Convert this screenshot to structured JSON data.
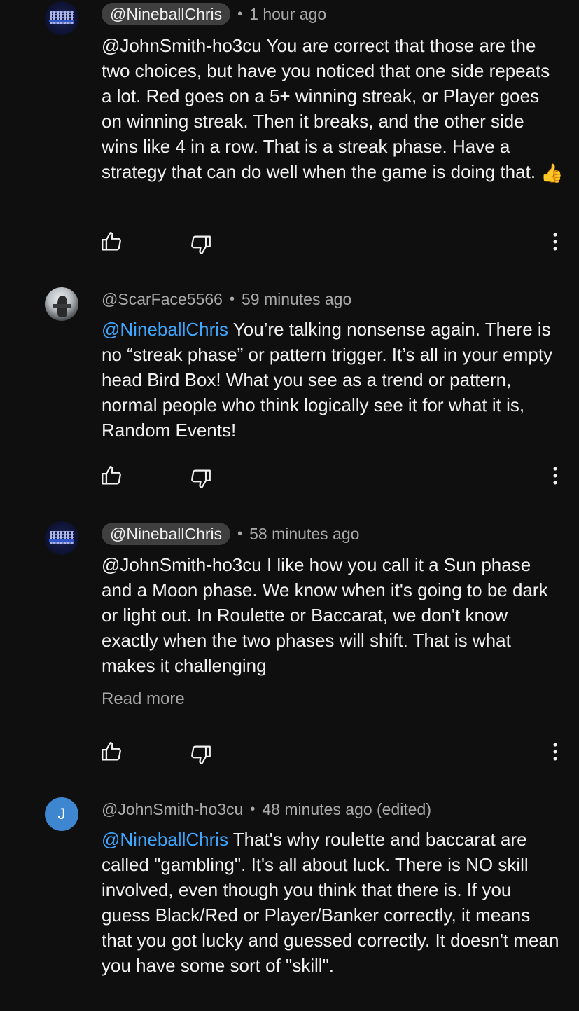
{
  "comments": [
    {
      "author": "@NineballChris",
      "author_style": "chip",
      "time": "1 hour ago",
      "text": "@JohnSmith-ho3cu You are correct that those are the two choices, but have you noticed that one side repeats a lot. Red goes on a 5+ winning streak, or Player goes on winning streak. Then it breaks, and the other side wins like 4 in a row. That is a streak phase. Have a strategy that can do well when the game is doing that.",
      "emoji": "👍",
      "avatar": "nineballchris-avatar"
    },
    {
      "author": "@ScarFace5566",
      "author_style": "plain",
      "time": "59 minutes ago",
      "mention": "@NineballChris",
      "text": "You’re talking nonsense again. There is no “streak phase” or pattern trigger. It’s all in your empty head Bird Box! What you see as a trend or pattern, normal people who think logically see it for what it is, Random Events!",
      "avatar": "scarface-avatar"
    },
    {
      "author": "@NineballChris",
      "author_style": "chip",
      "time": "58 minutes ago",
      "text": "@JohnSmith-ho3cu I like how you call it a Sun phase and a Moon phase. We know when it's going to be dark or light out. In Roulette or Baccarat, we don't know exactly when the two phases will shift. That is what makes it challenging",
      "read_more": "Read more",
      "avatar": "nineballchris-avatar"
    },
    {
      "author": "@JohnSmith-ho3cu",
      "author_style": "plain",
      "time": "48 minutes ago (edited)",
      "mention": "@NineballChris",
      "text": "That's why roulette and baccarat are called \"gambling\". It's all about luck. There is NO skill involved, even though you think that there is. If you guess Black/Red or Player/Banker correctly, it means that you got lucky and guessed correctly. It doesn't mean you have some sort of \"skill\".",
      "avatar_letter": "J"
    }
  ],
  "separator": "•",
  "colors": {
    "background": "#0f0f0f",
    "text": "#f1f1f1",
    "secondary": "#aaaaaa",
    "mention": "#3ea6ff",
    "chip": "#3f3f3f",
    "avatar_j": "#3f86d1"
  },
  "icons": [
    "like-icon",
    "dislike-icon",
    "more-vert-icon"
  ]
}
